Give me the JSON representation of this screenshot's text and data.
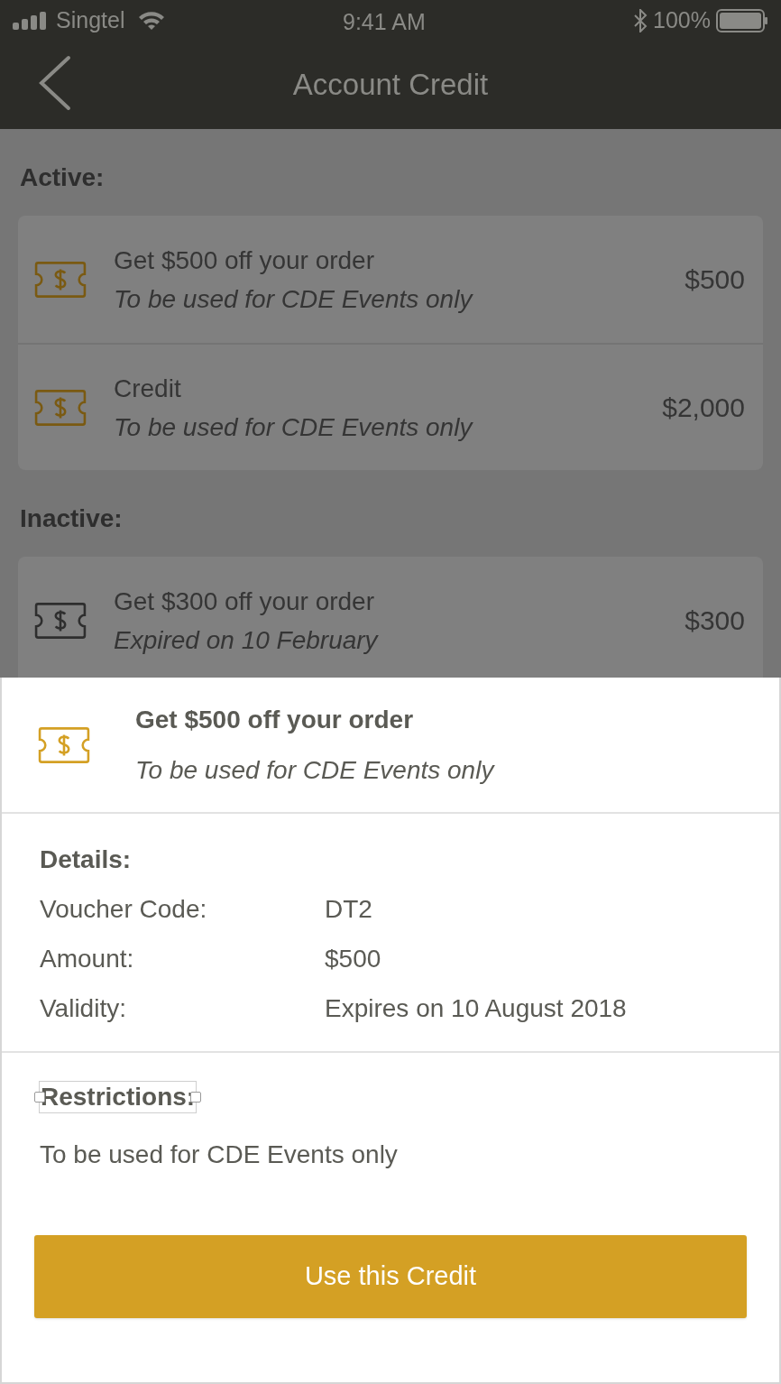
{
  "status_bar": {
    "carrier": "Singtel",
    "time": "9:41 AM",
    "battery": "100%"
  },
  "nav": {
    "title": "Account Credit"
  },
  "sections": [
    {
      "heading": "Active:",
      "items": [
        {
          "title": "Get $500 off your order",
          "subtitle": "To be used for CDE Events only",
          "amount": "$500",
          "active": true
        },
        {
          "title": "Credit",
          "subtitle": "To be used for CDE Events only",
          "amount": "$2,000",
          "active": true
        }
      ]
    },
    {
      "heading": "Inactive:",
      "items": [
        {
          "title": "Get $300 off your order",
          "subtitle": "Expired on 10 February",
          "amount": "$300",
          "active": false
        }
      ]
    }
  ],
  "sheet": {
    "title": "Get $500 off your order",
    "subtitle": "To be used for CDE Events only",
    "details_heading": "Details:",
    "details": [
      {
        "label": "Voucher Code:",
        "value": "DT2"
      },
      {
        "label": "Amount:",
        "value": "$500"
      },
      {
        "label": "Validity:",
        "value": "Expires on 10 August 2018"
      }
    ],
    "restrictions_heading": "Restrictions:",
    "restrictions_heading_selected": true,
    "restrictions": "To be used for CDE Events only",
    "button": "Use this Credit"
  }
}
